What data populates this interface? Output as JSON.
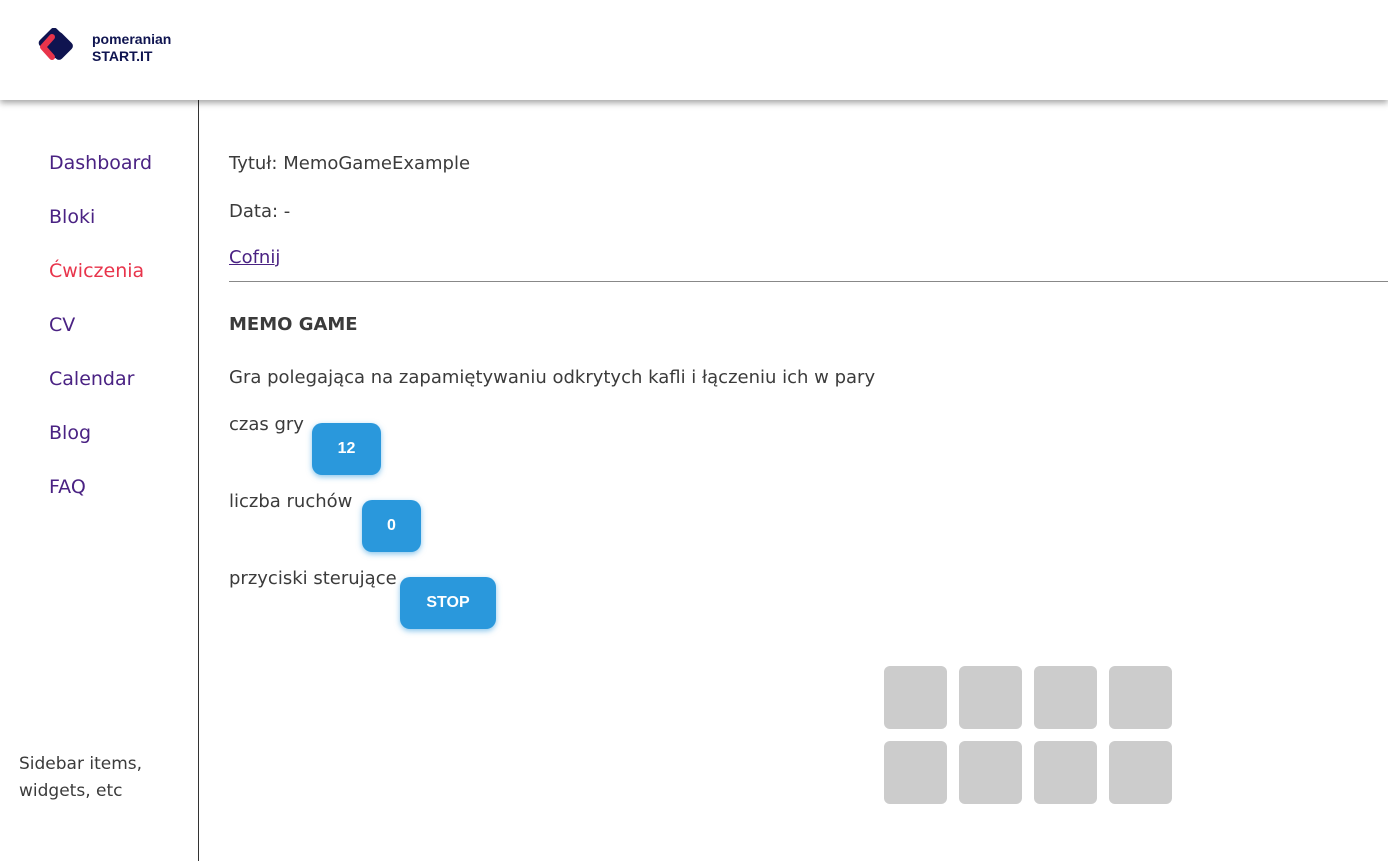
{
  "header": {
    "logo_line1": "pomeranian",
    "logo_line2": "START.IT",
    "colors": {
      "logo_dark": "#0f1450",
      "logo_accent": "#e8344b"
    }
  },
  "sidebar": {
    "items": [
      {
        "label": "Dashboard",
        "active": false
      },
      {
        "label": "Bloki",
        "active": false
      },
      {
        "label": "Ćwiczenia",
        "active": true
      },
      {
        "label": "CV",
        "active": false
      },
      {
        "label": "Calendar",
        "active": false
      },
      {
        "label": "Blog",
        "active": false
      },
      {
        "label": "FAQ",
        "active": false
      }
    ],
    "widgets_text": "Sidebar items, widgets, etc",
    "colors": {
      "item": "#4a2283",
      "active": "#e8344b"
    }
  },
  "main": {
    "title_line": "Tytuł: MemoGameExample",
    "date_line": "Data: -",
    "back_link": "Cofnij",
    "game": {
      "heading": "MEMO GAME",
      "description": "Gra polegająca na zapamiętywaniu odkrytych kafli i łączeniu ich w pary",
      "time_label": "czas gry",
      "time_value": "12",
      "moves_label": "liczba ruchów",
      "moves_value": "0",
      "controls_label": "przyciski sterujące",
      "stop_button": "STOP",
      "tiles": [
        {
          "state": "hidden"
        },
        {
          "state": "hidden"
        },
        {
          "state": "hidden"
        },
        {
          "state": "hidden"
        },
        {
          "state": "hidden"
        },
        {
          "state": "hidden"
        },
        {
          "state": "hidden"
        },
        {
          "state": "hidden"
        }
      ],
      "colors": {
        "button": "#2a98dc",
        "tile": "#cccccc"
      }
    }
  }
}
